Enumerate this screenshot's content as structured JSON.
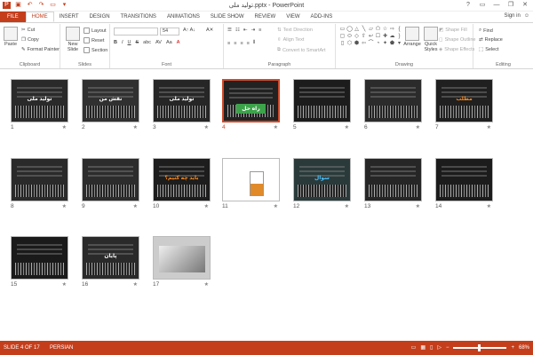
{
  "window": {
    "title": "تولید ملی.pptx - PowerPoint",
    "help": "?",
    "minimize": "—",
    "restore": "❐",
    "close": "✕",
    "signin": "Sign in"
  },
  "tabs": [
    "FILE",
    "HOME",
    "INSERT",
    "DESIGN",
    "TRANSITIONS",
    "ANIMATIONS",
    "SLIDE SHOW",
    "REVIEW",
    "VIEW",
    "ADD-INS"
  ],
  "clipboard": {
    "label": "Clipboard",
    "paste": "Paste",
    "cut": "Cut",
    "copy": "Copy",
    "format_painter": "Format Painter"
  },
  "slides_group": {
    "label": "Slides",
    "new_slide": "New Slide",
    "layout": "Layout",
    "reset": "Reset",
    "section": "Section"
  },
  "font": {
    "label": "Font",
    "size": "54"
  },
  "paragraph": {
    "label": "Paragraph",
    "text_direction": "Text Direction",
    "align_text": "Align Text",
    "convert": "Convert to SmartArt"
  },
  "drawing": {
    "label": "Drawing",
    "arrange": "Arrange",
    "quick_styles": "Quick Styles",
    "shape_fill": "Shape Fill",
    "shape_outline": "Shape Outline",
    "shape_effects": "Shape Effects"
  },
  "editing": {
    "label": "Editing",
    "find": "Find",
    "replace": "Replace",
    "select": "Select"
  },
  "slides": [
    {
      "n": "1",
      "text": "تولید ملی",
      "selected": false
    },
    {
      "n": "2",
      "text": "نقش من",
      "selected": false
    },
    {
      "n": "3",
      "text": "تولید ملی",
      "selected": false
    },
    {
      "n": "4",
      "text": "راه حل",
      "selected": true
    },
    {
      "n": "5",
      "text": "",
      "selected": false
    },
    {
      "n": "6",
      "text": "",
      "selected": false
    },
    {
      "n": "7",
      "text": "مطلب",
      "selected": false
    },
    {
      "n": "8",
      "text": "",
      "selected": false
    },
    {
      "n": "9",
      "text": "",
      "selected": false
    },
    {
      "n": "10",
      "text": "باید چه کنیم؟",
      "selected": false
    },
    {
      "n": "11",
      "text": "",
      "selected": false
    },
    {
      "n": "12",
      "text": "سوال",
      "selected": false
    },
    {
      "n": "13",
      "text": "",
      "selected": false
    },
    {
      "n": "14",
      "text": "",
      "selected": false
    },
    {
      "n": "15",
      "text": "",
      "selected": false
    },
    {
      "n": "16",
      "text": "پایان",
      "selected": false
    },
    {
      "n": "17",
      "text": "",
      "selected": false
    }
  ],
  "status": {
    "slide_info": "SLIDE 4 OF 17",
    "language": "PERSIAN",
    "zoom": "68%"
  }
}
